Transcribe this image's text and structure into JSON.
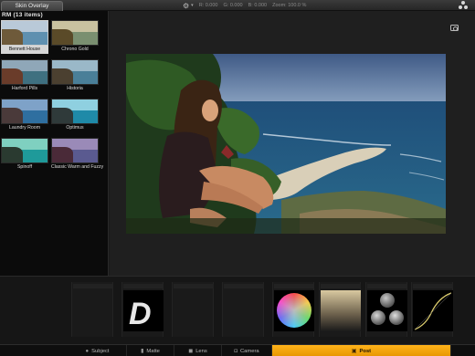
{
  "topbar": {
    "active_tab": "Skin Overlay",
    "readout_r": "R: 0.000",
    "readout_g": "G: 0.000",
    "readout_b": "B: 0.000",
    "zoom": "Zoom: 100.0 %"
  },
  "presets": {
    "title": "RM (13 items)",
    "items": [
      {
        "label": "Bennett House",
        "selected": true,
        "sky": "#b9c9d8",
        "sea": "#5f90b0",
        "land": "#6e5a3a"
      },
      {
        "label": "Chrono Gold",
        "selected": false,
        "sky": "#c9c2a0",
        "sea": "#7a8f70",
        "land": "#5a4a28"
      },
      {
        "label": "Harford Pills",
        "selected": false,
        "sky": "#8fa7b8",
        "sea": "#3f7080",
        "land": "#6a3c2a"
      },
      {
        "label": "Historia",
        "selected": false,
        "sky": "#9ab8c8",
        "sea": "#4a7f98",
        "land": "#4b4030"
      },
      {
        "label": "Laundry Room",
        "selected": false,
        "sky": "#7ea2c8",
        "sea": "#2f6fa0",
        "land": "#4a3a3a"
      },
      {
        "label": "Optimus",
        "selected": false,
        "sky": "#8fd0e0",
        "sea": "#1f8aa8",
        "land": "#2f3a3a"
      },
      {
        "label": "Spinoff",
        "selected": false,
        "sky": "#7fd0c0",
        "sea": "#1f9a9a",
        "land": "#2a3a30"
      },
      {
        "label": "Classic Warm and Fuzzy",
        "selected": false,
        "sky": "#9a8ab8",
        "sea": "#5a5a90",
        "land": "#4a2a38"
      }
    ]
  },
  "tools": [
    {
      "name": "empty"
    },
    {
      "name": "D"
    },
    {
      "name": "empty"
    },
    {
      "name": "empty"
    },
    {
      "name": "color-wheel"
    },
    {
      "name": "gradient"
    },
    {
      "name": "circles"
    },
    {
      "name": "curve"
    }
  ],
  "tabs": [
    {
      "label": "Subject",
      "icon": "person-icon",
      "active": false
    },
    {
      "label": "Matte",
      "icon": "matte-icon",
      "active": false
    },
    {
      "label": "Lens",
      "icon": "lens-icon",
      "active": false
    },
    {
      "label": "Camera",
      "icon": "camera-icon",
      "active": false
    },
    {
      "label": "Post",
      "icon": "post-icon",
      "active": true
    }
  ],
  "colors": {
    "accent": "#f5a623",
    "selected_preset": "#d6d6d6"
  }
}
